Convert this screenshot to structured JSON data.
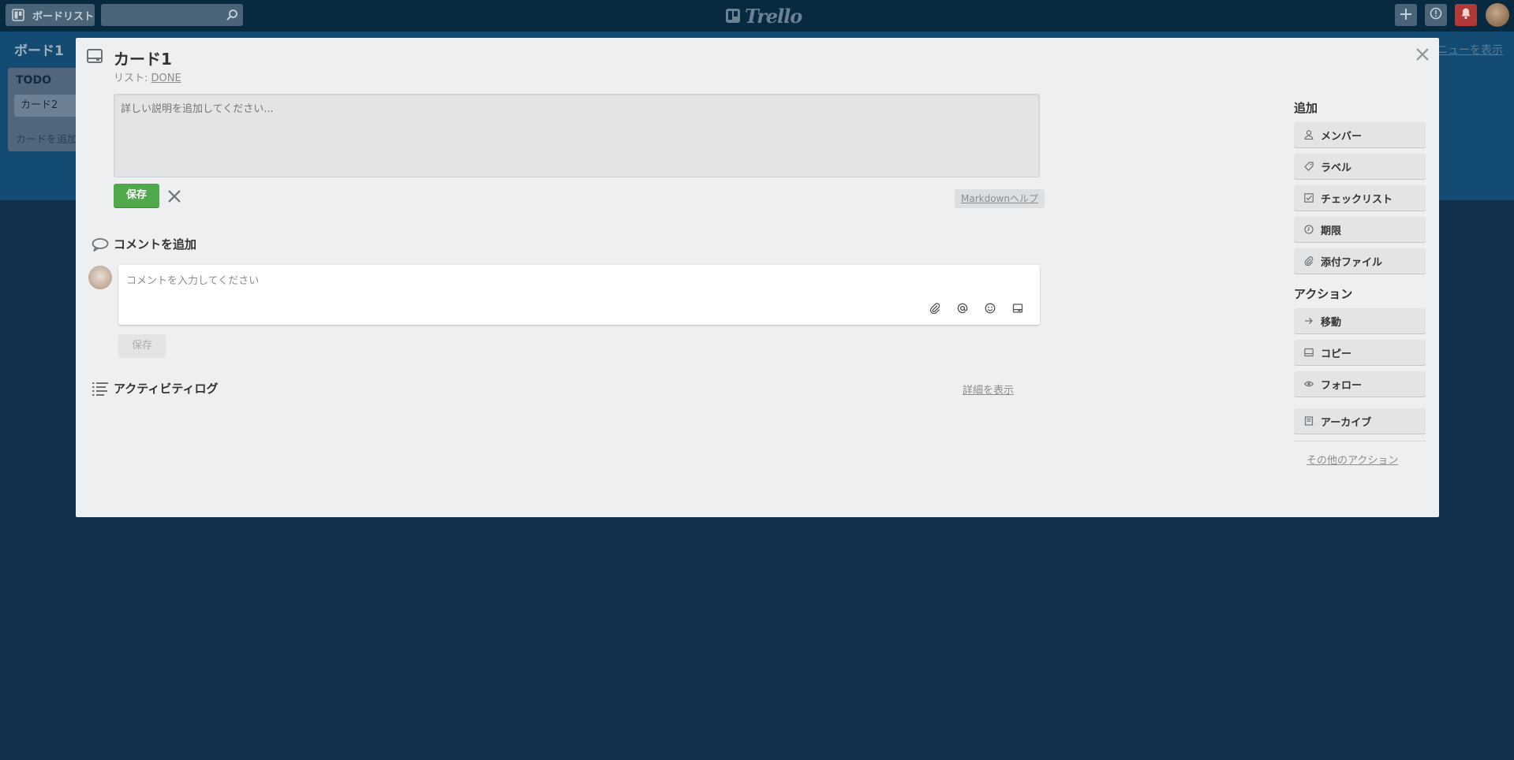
{
  "header": {
    "boards_label": "ボードリスト",
    "search_value": "",
    "logo_text": "Trello"
  },
  "board": {
    "title": "ボード1",
    "menu_link": "ニューを表示",
    "list": {
      "title": "TODO",
      "cards": [
        "カード2"
      ],
      "add_card": "カードを追加"
    }
  },
  "card_modal": {
    "title": "カード1",
    "list_prefix": "リスト:",
    "list_name": "DONE",
    "description_placeholder": "詳しい説明を追加してください...",
    "save_label": "保存",
    "markdown_help": "Markdownヘルプ",
    "comment_section_title": "コメントを追加",
    "comment_placeholder": "コメントを入力してください",
    "comment_save_label": "保存",
    "activity_title": "アクティビティログ",
    "activity_details": "詳細を表示"
  },
  "sidebar": {
    "add_heading": "追加",
    "add_items": [
      {
        "label": "メンバー",
        "icon": "person-icon"
      },
      {
        "label": "ラベル",
        "icon": "tag-icon"
      },
      {
        "label": "チェックリスト",
        "icon": "checkbox-icon"
      },
      {
        "label": "期限",
        "icon": "clock-icon"
      },
      {
        "label": "添付ファイル",
        "icon": "paperclip-icon"
      }
    ],
    "actions_heading": "アクション",
    "action_items": [
      {
        "label": "移動",
        "icon": "arrow-right-icon"
      },
      {
        "label": "コピー",
        "icon": "card-icon"
      },
      {
        "label": "フォロー",
        "icon": "eye-icon"
      },
      {
        "label": "アーカイブ",
        "icon": "archive-icon"
      }
    ],
    "more_actions": "その他のアクション"
  },
  "colors": {
    "header_bg": "#072a41",
    "board_bg": "#144b73",
    "overlay_bg": "#12304b",
    "modal_bg": "#edeff0",
    "save_green": "#4fa84a",
    "notification_red": "#b03a37"
  }
}
